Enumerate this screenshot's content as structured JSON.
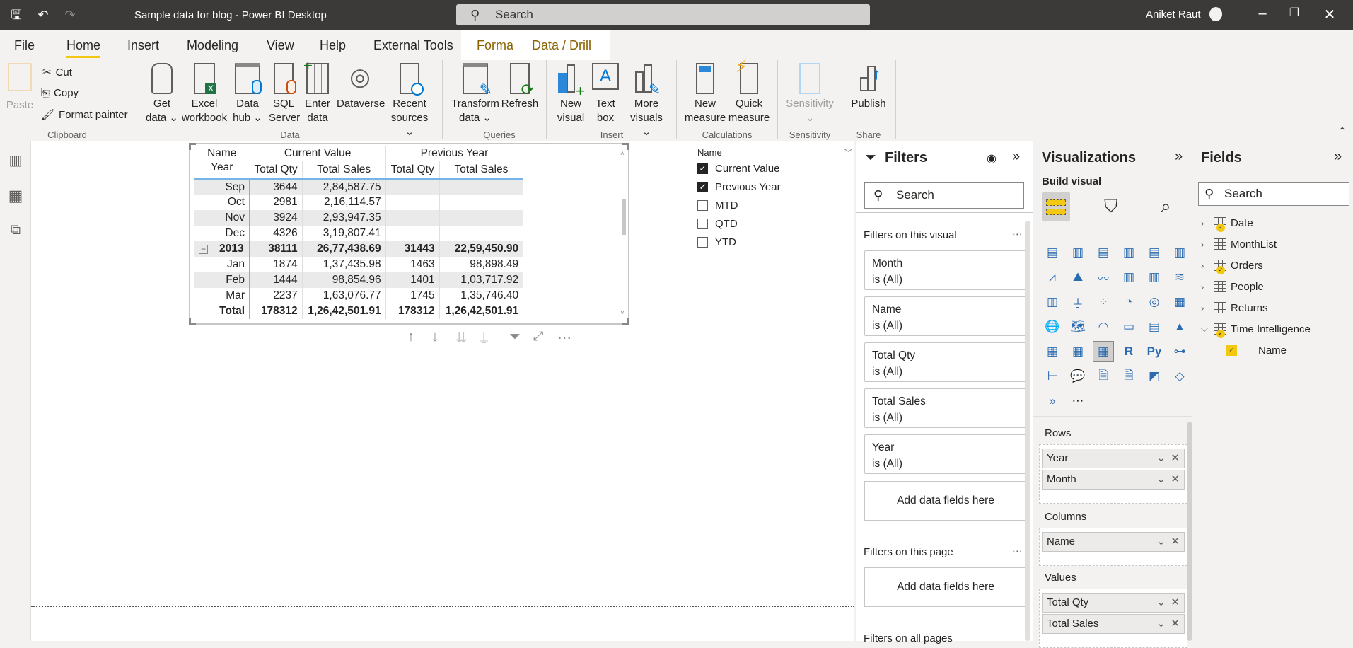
{
  "titlebar": {
    "title": "Sample data for blog - Power BI Desktop",
    "search_placeholder": "Search",
    "user": "Aniket Raut"
  },
  "tabs": [
    "File",
    "Home",
    "Insert",
    "Modeling",
    "View",
    "Help",
    "External Tools",
    "Format",
    "Data / Drill"
  ],
  "ribbon": {
    "clipboard": {
      "paste": "Paste",
      "cut": "Cut",
      "copy": "Copy",
      "format_painter": "Format painter",
      "group": "Clipboard"
    },
    "data": {
      "get_data": [
        "Get",
        "data"
      ],
      "excel": [
        "Excel",
        "workbook"
      ],
      "data_hub": [
        "Data",
        "hub"
      ],
      "sql": [
        "SQL",
        "Server"
      ],
      "enter": [
        "Enter",
        "data"
      ],
      "dataverse": "Dataverse",
      "recent": [
        "Recent",
        "sources"
      ],
      "group": "Data"
    },
    "queries": {
      "transform": [
        "Transform",
        "data"
      ],
      "refresh": "Refresh",
      "group": "Queries"
    },
    "insert": {
      "new_visual": [
        "New",
        "visual"
      ],
      "text_box": [
        "Text",
        "box"
      ],
      "more_visuals": [
        "More",
        "visuals"
      ],
      "group": "Insert"
    },
    "calculations": {
      "new_measure": [
        "New",
        "measure"
      ],
      "quick_measure": [
        "Quick",
        "measure"
      ],
      "group": "Calculations"
    },
    "sensitivity": {
      "label": "Sensitivity",
      "group": "Sensitivity"
    },
    "share": {
      "publish": "Publish",
      "group": "Share"
    }
  },
  "matrix": {
    "header_row1": [
      "Name",
      "Current Value",
      "Previous Year"
    ],
    "header_row2": [
      "Year",
      "Total Qty",
      "Total Sales",
      "Total Qty",
      "Total Sales"
    ],
    "rows": [
      {
        "label": "Sep",
        "cq": "3644",
        "cs": "2,84,587.75",
        "pq": "",
        "ps": "",
        "shade": true,
        "bold": false
      },
      {
        "label": "Oct",
        "cq": "2981",
        "cs": "2,16,114.57",
        "pq": "",
        "ps": "",
        "shade": false,
        "bold": false
      },
      {
        "label": "Nov",
        "cq": "3924",
        "cs": "2,93,947.35",
        "pq": "",
        "ps": "",
        "shade": true,
        "bold": false
      },
      {
        "label": "Dec",
        "cq": "4326",
        "cs": "3,19,807.41",
        "pq": "",
        "ps": "",
        "shade": false,
        "bold": false
      },
      {
        "label": "2013",
        "cq": "38111",
        "cs": "26,77,438.69",
        "pq": "31443",
        "ps": "22,59,450.90",
        "shade": true,
        "bold": true,
        "expander": "−"
      },
      {
        "label": "Jan",
        "cq": "1874",
        "cs": "1,37,435.98",
        "pq": "1463",
        "ps": "98,898.49",
        "shade": false,
        "bold": false
      },
      {
        "label": "Feb",
        "cq": "1444",
        "cs": "98,854.96",
        "pq": "1401",
        "ps": "1,03,717.92",
        "shade": true,
        "bold": false
      },
      {
        "label": "Mar",
        "cq": "2237",
        "cs": "1,63,076.77",
        "pq": "1745",
        "ps": "1,35,746.40",
        "shade": false,
        "bold": false
      },
      {
        "label": "Total",
        "cq": "178312",
        "cs": "1,26,42,501.91",
        "pq": "178312",
        "ps": "1,26,42,501.91",
        "shade": false,
        "bold": true
      }
    ]
  },
  "slicer": {
    "title": "Name",
    "items": [
      {
        "label": "Current Value",
        "checked": true
      },
      {
        "label": "Previous Year",
        "checked": true
      },
      {
        "label": "MTD",
        "checked": false
      },
      {
        "label": "QTD",
        "checked": false
      },
      {
        "label": "YTD",
        "checked": false
      }
    ]
  },
  "filters": {
    "title": "Filters",
    "search": "Search",
    "on_visual": "Filters on this visual",
    "cards": [
      {
        "name": "Month",
        "state": "is (All)"
      },
      {
        "name": "Name",
        "state": "is (All)"
      },
      {
        "name": "Total Qty",
        "state": "is (All)"
      },
      {
        "name": "Total Sales",
        "state": "is (All)"
      },
      {
        "name": "Year",
        "state": "is (All)"
      }
    ],
    "add": "Add data fields here",
    "on_page": "Filters on this page",
    "on_all": "Filters on all pages"
  },
  "viz": {
    "title": "Visualizations",
    "build": "Build visual",
    "rows_label": "Rows",
    "rows": [
      "Year",
      "Month"
    ],
    "columns_label": "Columns",
    "columns": [
      "Name"
    ],
    "values_label": "Values",
    "values": [
      "Total Qty",
      "Total Sales"
    ]
  },
  "fields": {
    "title": "Fields",
    "search": "Search",
    "tables": [
      {
        "name": "Date",
        "used": true,
        "expanded": false
      },
      {
        "name": "MonthList",
        "used": false,
        "expanded": false
      },
      {
        "name": "Orders",
        "used": true,
        "expanded": false
      },
      {
        "name": "People",
        "used": false,
        "expanded": false
      },
      {
        "name": "Returns",
        "used": false,
        "expanded": false
      },
      {
        "name": "Time Intelligence",
        "used": true,
        "expanded": true
      }
    ],
    "child": "Name"
  }
}
